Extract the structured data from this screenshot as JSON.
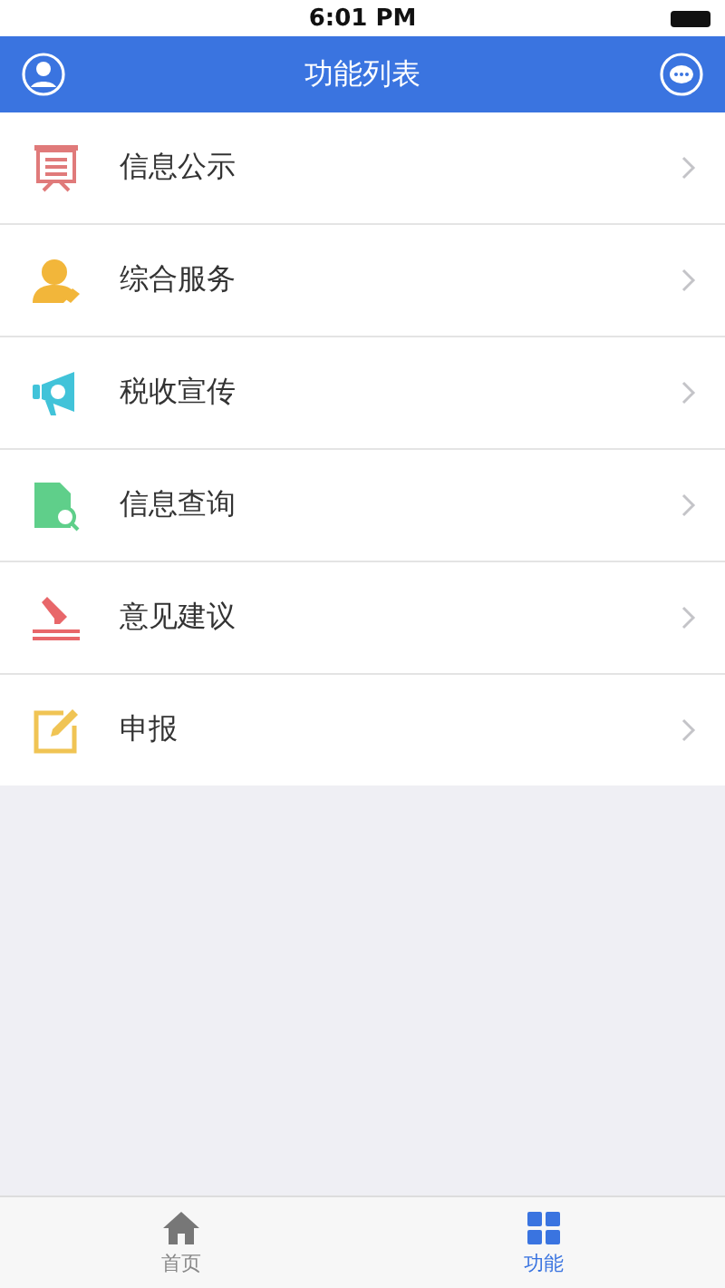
{
  "status_bar": {
    "time": "6:01 PM"
  },
  "nav_bar": {
    "title": "功能列表"
  },
  "menu_items": [
    {
      "label": "信息公示"
    },
    {
      "label": "综合服务"
    },
    {
      "label": "税收宣传"
    },
    {
      "label": "信息查询"
    },
    {
      "label": "意见建议"
    },
    {
      "label": "申报"
    }
  ],
  "tab_bar": [
    {
      "label": "首页",
      "selected": false
    },
    {
      "label": "功能",
      "selected": true
    }
  ]
}
